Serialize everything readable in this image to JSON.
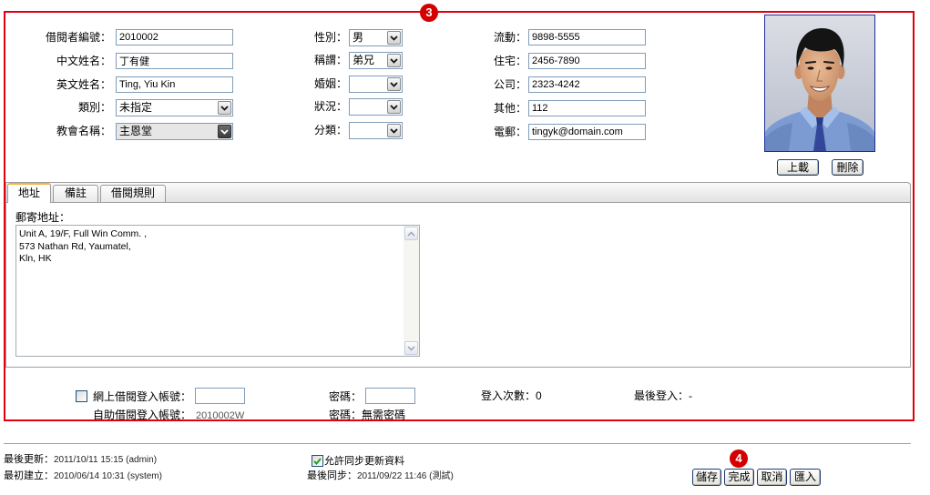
{
  "markers": {
    "main_section": "3",
    "actions": "4"
  },
  "personal": {
    "borrower_no": {
      "label": "借閱者編號：",
      "value": "2010002"
    },
    "chinese_name": {
      "label": "中文姓名：",
      "value": "丁有健"
    },
    "english_name": {
      "label": "英文姓名：",
      "value": "Ting, Yiu Kin"
    },
    "category": {
      "label": "類別：",
      "value": "未指定"
    },
    "church": {
      "label": "教會名稱：",
      "value": "主恩堂"
    }
  },
  "attributes": {
    "gender": {
      "label": "性別：",
      "value": "男"
    },
    "title": {
      "label": "稱謂：",
      "value": "弟兄"
    },
    "marital": {
      "label": "婚姻：",
      "value": ""
    },
    "status": {
      "label": "狀況：",
      "value": ""
    },
    "classification": {
      "label": "分類：",
      "value": ""
    }
  },
  "contact": {
    "mobile": {
      "label": "流動：",
      "value": "9898-5555"
    },
    "home": {
      "label": "住宅：",
      "value": "2456-7890"
    },
    "office": {
      "label": "公司：",
      "value": "2323-4242"
    },
    "other": {
      "label": "其他：",
      "value": "112"
    },
    "email": {
      "label": "電郵：",
      "value": "tingyk@domain.com"
    }
  },
  "photo": {
    "upload_label": "上載",
    "delete_label": "刪除"
  },
  "tabs": [
    {
      "label": "地址",
      "active": true
    },
    {
      "label": "備註",
      "active": false
    },
    {
      "label": "借閱規則",
      "active": false
    }
  ],
  "address": {
    "label": "郵寄地址：",
    "value": "Unit A, 19/F, Full Win Comm. ,\n573 Nathan Rd, Yaumatel,\nKln, HK"
  },
  "login": {
    "online_account_label": "網上借閱登入帳號：",
    "online_account_checked": false,
    "online_account_value": "",
    "online_password_label": "密碼：",
    "online_password_value": "",
    "login_count_label": "登入次數：",
    "login_count_value": "0",
    "last_login_label": "最後登入：",
    "last_login_value": "-",
    "self_service_label": "自助借閱登入帳號：",
    "self_service_value": "2010002W",
    "self_service_password_label": "密碼：",
    "self_service_password_value": "無需密碼"
  },
  "footer": {
    "last_updated_label": "最後更新：",
    "last_updated_value": "2011/10/11 15:15 (admin)",
    "created_label": "最初建立：",
    "created_value": "2010/06/14 10:31 (system)",
    "allow_sync_label": "允許同步更新資料",
    "allow_sync_checked": true,
    "last_sync_label": "最後同步：",
    "last_sync_value": "2011/09/22 11:46 (測試)"
  },
  "actions": {
    "save": "儲存",
    "done": "完成",
    "cancel": "取消",
    "import": "匯入"
  },
  "icons": {
    "dropdown": "chevron-down-icon",
    "checkbox_checked": "check-icon",
    "scroll_up": "scroll-up-arrow-icon",
    "scroll_down": "scroll-down-arrow-icon"
  },
  "colors": {
    "highlight_border": "#e1000f",
    "marker": "#d40000",
    "photo_border": "#1f2f9a",
    "input_border": "#7f9db9",
    "tab_active_top": "#f2b33d"
  }
}
